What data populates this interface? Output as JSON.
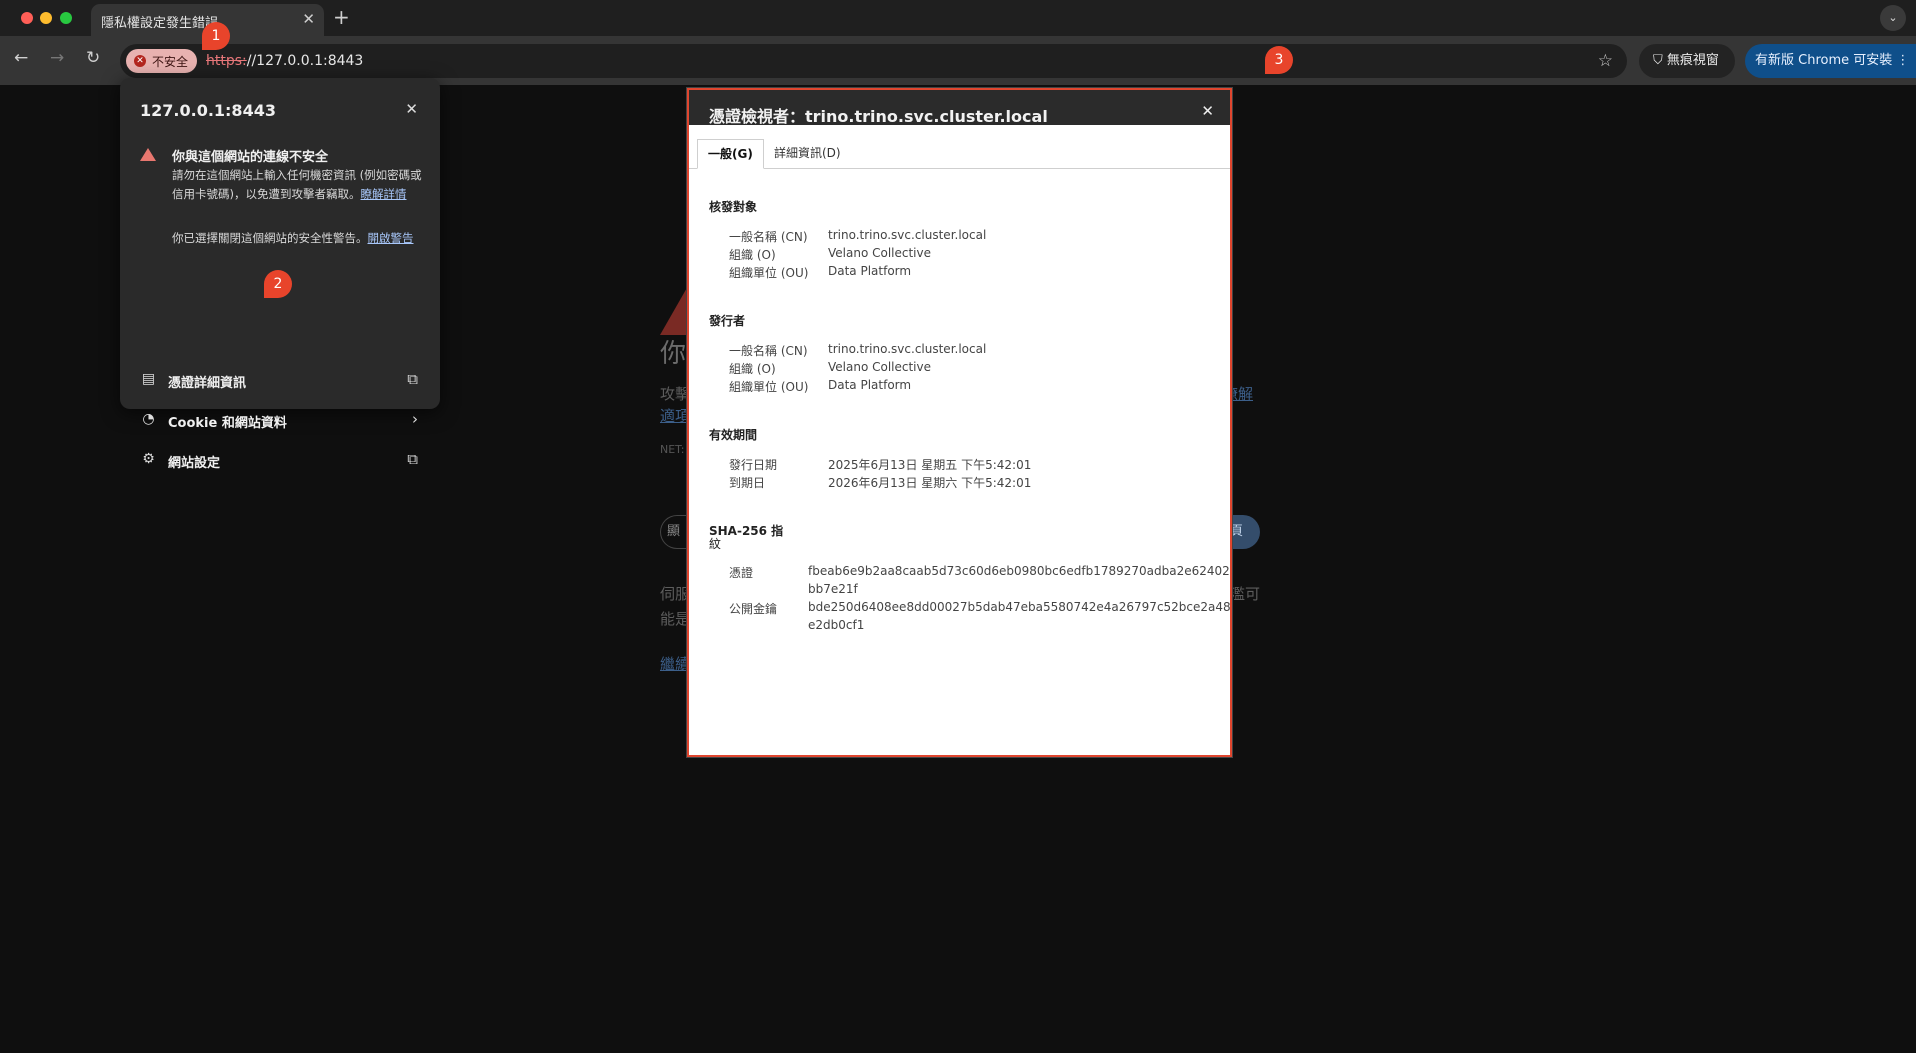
{
  "browser": {
    "tab_title": "隱私權設定發生錯誤",
    "tab_close": "✕",
    "new_tab": "+",
    "tab_search": "⌄",
    "security_chip_label": "不安全",
    "url_scheme": "https:",
    "url_rest": "//127.0.0.1:8443",
    "incognito_label": "無痕視窗",
    "update_label": "有新版 Chrome 可安裝"
  },
  "background_page": {
    "heading": "你",
    "text": "攻擊",
    "learn_more_fragment": "瞭解",
    "learn_more_fragment2": "適項",
    "code": "NET:",
    "btn_left_fragment": "顯",
    "btn_right_fragment": "頁",
    "foot": "伺服",
    "foot2": "能是",
    "foot_right": "濫可",
    "continue_fragment": "繼續"
  },
  "site_popup": {
    "title": "127.0.0.1:8443",
    "warning_title": "你與這個網站的連線不安全",
    "warning_body": "請勿在這個網站上輸入任何機密資訊 (例如密碼或信用卡號碼)，以免遭到攻擊者竊取。",
    "warning_link": "瞭解詳情",
    "security_text": "你已選擇關閉這個網站的安全性警告。",
    "security_link": "開啟警告",
    "rows": [
      {
        "label": "憑證詳細資訊",
        "icon": "certificate-icon",
        "trail": "external-link-icon"
      },
      {
        "label": "Cookie 和網站資料",
        "icon": "cookie-icon",
        "trail": "chevron-right-icon"
      },
      {
        "label": "網站設定",
        "icon": "gear-icon",
        "trail": "external-link-icon"
      }
    ]
  },
  "cert_viewer": {
    "title": "憑證檢視者：trino.trino.svc.cluster.local",
    "tabs": [
      "一般(G)",
      "詳細資訊(D)"
    ],
    "issued_to": {
      "heading": "核發對象",
      "rows": [
        {
          "k": "一般名稱 (CN)",
          "v": "trino.trino.svc.cluster.local"
        },
        {
          "k": "組織 (O)",
          "v": "Velano Collective"
        },
        {
          "k": "組織單位 (OU)",
          "v": "Data Platform"
        }
      ]
    },
    "issued_by": {
      "heading": "發行者",
      "rows": [
        {
          "k": "一般名稱 (CN)",
          "v": "trino.trino.svc.cluster.local"
        },
        {
          "k": "組織 (O)",
          "v": "Velano Collective"
        },
        {
          "k": "組織單位 (OU)",
          "v": "Data Platform"
        }
      ]
    },
    "validity": {
      "heading": "有效期間",
      "rows": [
        {
          "k": "發行日期",
          "v": "2025年6月13日 星期五 下午5:42:01"
        },
        {
          "k": "到期日",
          "v": "2026年6月13日 星期六 下午5:42:01"
        }
      ]
    },
    "fingerprints": {
      "heading_line1": "SHA-256 指",
      "heading_line2": "紋",
      "cert_label": "憑證",
      "cert_line1": "fbeab6e9b2aa8caab5d73c60d6eb0980bc6edfb1789270adba2e62402",
      "cert_line2": "bb7e21f",
      "pubkey_label": "公開金鑰",
      "pubkey_line1": "bde250d6408ee8dd00027b5dab47eba5580742e4a26797c52bce2a48",
      "pubkey_line2": "e2db0cf1"
    }
  },
  "callouts": [
    "1",
    "2",
    "3"
  ],
  "colors": {
    "accent_red": "#e8442b",
    "chip_bg": "#e8b2b0",
    "update_blue": "#0f4f8a"
  }
}
